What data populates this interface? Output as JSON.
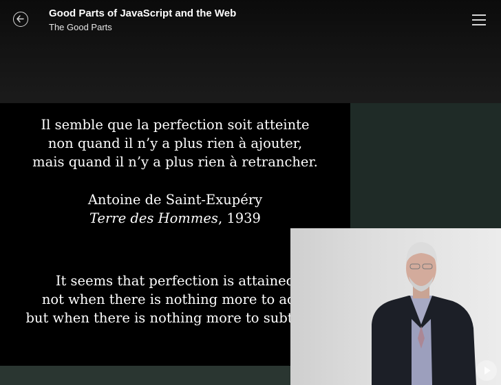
{
  "header": {
    "course_title": "Good Parts of JavaScript and the Web",
    "module_title": "The Good Parts",
    "back_icon": "arrow-left-circle-icon",
    "menu_icon": "hamburger-menu-icon"
  },
  "slide": {
    "french_lines": [
      "Il semble que la perfection soit atteinte",
      "non quand il n’y a plus rien à ajouter,",
      "mais quand il n’y a plus rien à retrancher."
    ],
    "author": "Antoine de Saint-Exupéry",
    "work_title": "Terre des Hommes",
    "work_year": ", 1939",
    "english_lines": [
      "It seems that perfection is attained",
      "not when there is nothing more to add,",
      "but when there is nothing more to subtract."
    ]
  },
  "player": {
    "play_icon": "play-icon"
  },
  "colors": {
    "header_bg": "#131313",
    "slide_bg": "#000000",
    "video_bg": "#1f2b27"
  }
}
